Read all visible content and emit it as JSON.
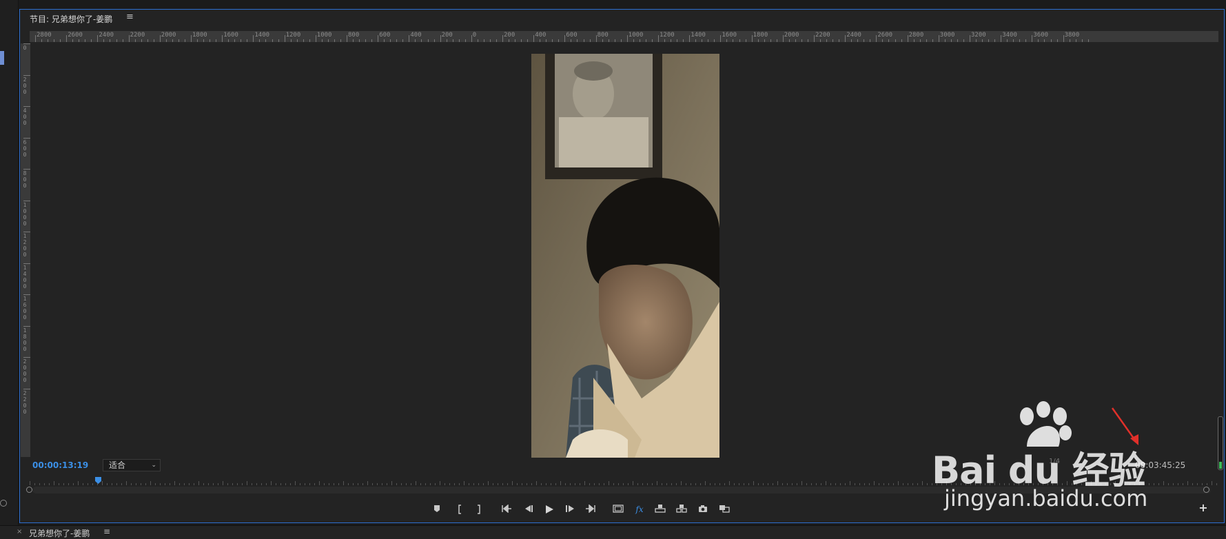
{
  "panel": {
    "title": "节目: 兄弟想你了-姜鹏",
    "menu_icon": "≡"
  },
  "ruler": {
    "horizontal_labels": [
      "2800",
      "2600",
      "2400",
      "2200",
      "2000",
      "1800",
      "1600",
      "1400",
      "1200",
      "1000",
      "800",
      "600",
      "400",
      "200",
      "0",
      "200",
      "400",
      "600",
      "800",
      "1000",
      "1200",
      "1400",
      "1600",
      "1800",
      "2000",
      "2200",
      "2400",
      "2600",
      "2800",
      "3000",
      "3200",
      "3400",
      "3600",
      "3800"
    ],
    "vertical_labels": [
      "0",
      "200",
      "400",
      "600",
      "800",
      "1000",
      "1200",
      "1400",
      "1600",
      "1800",
      "2000",
      "2200"
    ]
  },
  "monitor": {
    "current_timecode": "00:00:13:19",
    "zoom_select": "适合",
    "resolution": "1/4",
    "duration_timecode": "00:03:45:25"
  },
  "controls": [
    {
      "name": "add-marker-button",
      "icon": "marker-icon"
    },
    {
      "name": "mark-in-button",
      "icon": "mark-in-icon"
    },
    {
      "name": "mark-out-button",
      "icon": "mark-out-icon"
    },
    {
      "name": "go-to-in-button",
      "icon": "go-to-in-icon"
    },
    {
      "name": "step-back-button",
      "icon": "step-back-icon"
    },
    {
      "name": "play-button",
      "icon": "play-icon"
    },
    {
      "name": "step-forward-button",
      "icon": "step-forward-icon"
    },
    {
      "name": "go-to-out-button",
      "icon": "go-to-out-icon"
    },
    {
      "name": "safe-margins-button",
      "icon": "safe-margins-icon"
    },
    {
      "name": "fx-button",
      "icon": "fx-icon",
      "label": "fx"
    },
    {
      "name": "lift-button",
      "icon": "lift-icon"
    },
    {
      "name": "extract-button",
      "icon": "extract-icon"
    },
    {
      "name": "export-frame-button",
      "icon": "camera-icon"
    },
    {
      "name": "compare-view-button",
      "icon": "compare-icon"
    }
  ],
  "bottom_panel": {
    "title": "兄弟想你了-姜鹏",
    "close": "×",
    "menu_icon": "≡"
  },
  "watermark": {
    "brand": "Bai du 经验",
    "url": "jingyan.baidu.com"
  },
  "colors": {
    "panel_border": "#2d6fd1",
    "timecode_blue": "#3b8fe6",
    "background": "#232323"
  }
}
